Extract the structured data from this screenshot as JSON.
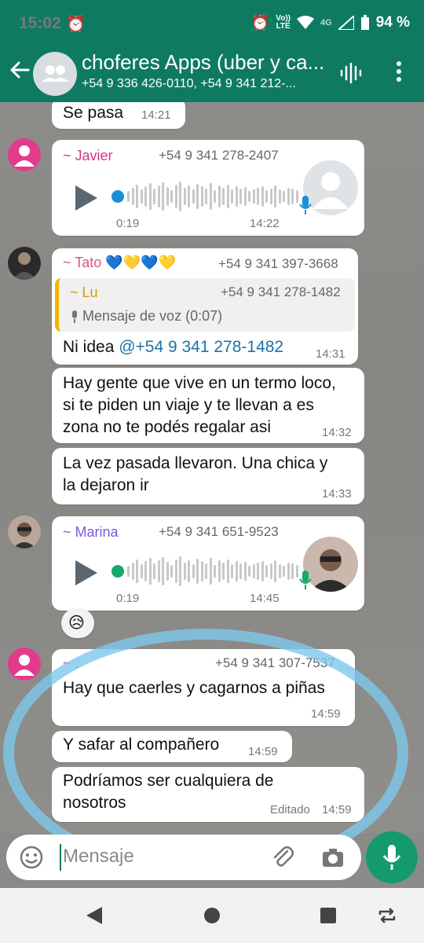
{
  "status": {
    "time": "15:02",
    "net_top": "Vo))",
    "net_bottom": "LTE",
    "signal_type": "4G",
    "battery": "94 %"
  },
  "header": {
    "title": "choferes Apps (uber y ca...",
    "subtitle": "+54 9 336 426-0110, +54 9 341 212-..."
  },
  "messages": [
    {
      "text": "Se pasa",
      "time": "14:21"
    },
    {
      "sender": "~ Javier",
      "phone": "+54 9 341 278-2407",
      "duration": "0:19",
      "time": "14:22",
      "sender_color": "#d6338a"
    },
    {
      "sender": "~ Tato 💙💛💙💛",
      "phone": "+54 9 341 397-3668",
      "sender_color": "#e0507a",
      "quote": {
        "sender": "~ Lu",
        "phone": "+54 9 341 278-1482",
        "text": "Mensaje de voz (0:07)"
      },
      "text_prefix": "Ni idea ",
      "mention": "@+54 9 341 278-1482",
      "time": "14:31"
    },
    {
      "line1": "Hay gente que vive en un termo loco,",
      "line2": "si te piden un viaje y te llevan a es",
      "line3": "zona no te podés regalar asi",
      "time": "14:32"
    },
    {
      "line1": "La vez pasada llevaron. Una chica y",
      "line2": "la dejaron ir",
      "time": "14:33"
    },
    {
      "sender": "~ Marina",
      "phone": "+54 9 341 651-9523",
      "duration": "0:19",
      "time": "14:45",
      "sender_color": "#7b5bd6",
      "reaction": "😥"
    },
    {
      "sender": "~ .",
      "phone": "+54 9 341 307-7537",
      "text": "Hay que caerles y cagarnos a piñas",
      "time": "14:59",
      "sender_color": "#d6338a"
    },
    {
      "text": "Y safar al compañero",
      "time": "14:59"
    },
    {
      "line1": "Podríamos ser cualquiera de",
      "line2": "nosotros",
      "edited": "Editado",
      "time": "14:59"
    }
  ],
  "input": {
    "placeholder": "Mensaje"
  },
  "colors": {
    "header": "#0f7a62",
    "accent": "#159a6e",
    "link": "#1a73a8"
  }
}
